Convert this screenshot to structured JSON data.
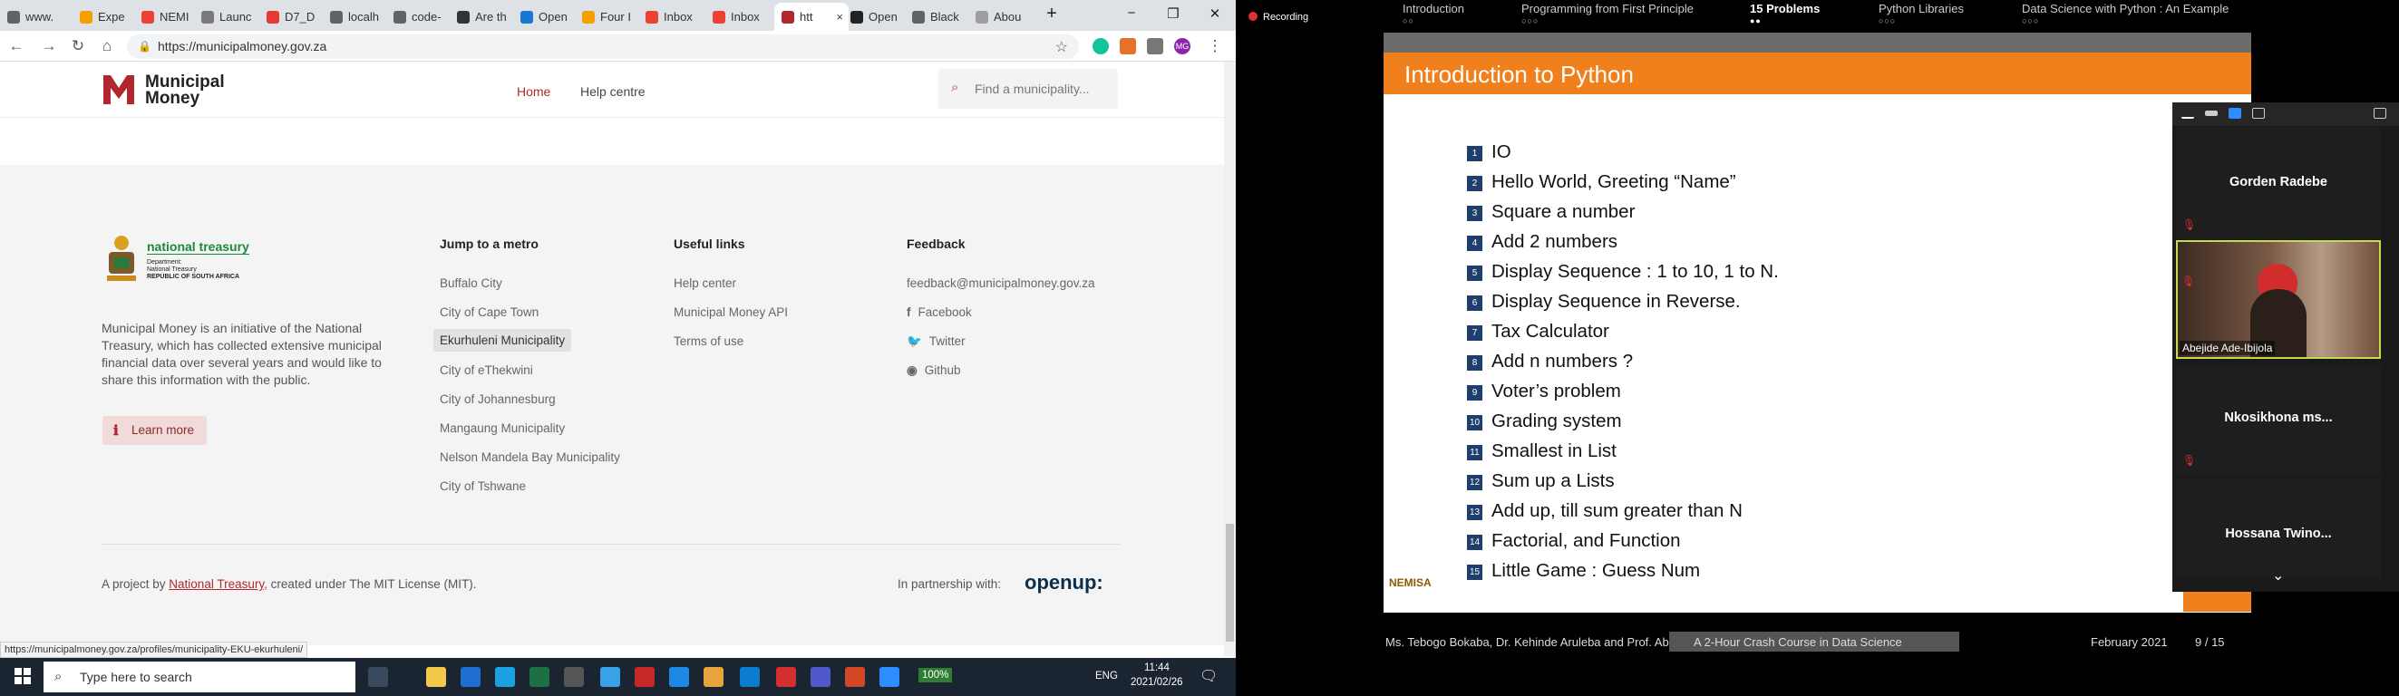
{
  "browser": {
    "tabs": [
      {
        "label": "www.",
        "color": "#5f6368"
      },
      {
        "label": "Expe",
        "color": "#f4a100"
      },
      {
        "label": "NEMI",
        "color": "#ea4335"
      },
      {
        "label": "Launc",
        "color": "#7a7a7a"
      },
      {
        "label": "D7_D",
        "color": "#e53935"
      },
      {
        "label": "localh",
        "color": "#5f6368"
      },
      {
        "label": "code-",
        "color": "#5f6368"
      },
      {
        "label": "Are th",
        "color": "#333333"
      },
      {
        "label": "Open",
        "color": "#1976d2"
      },
      {
        "label": "Four I",
        "color": "#f4a100"
      },
      {
        "label": "Inbox",
        "color": "#ea4335"
      },
      {
        "label": "Inbox",
        "color": "#ea4335"
      },
      {
        "label": "htt",
        "color": "#b0282e"
      },
      {
        "label": "Open",
        "color": "#222222"
      },
      {
        "label": "Black",
        "color": "#5f6368"
      },
      {
        "label": "Abou",
        "color": "#9e9e9e"
      }
    ],
    "active_tab_close": "×",
    "new_tab": "+",
    "win_min": "−",
    "win_max": "❐",
    "win_close": "✕",
    "url": "https://municipalmoney.gov.za",
    "avatar": "MG",
    "status_url": "https://municipalmoney.gov.za/profiles/municipality-EKU-ekurhuleni/"
  },
  "site": {
    "logo_line1": "Municipal",
    "logo_line2": "Money",
    "nav_home": "Home",
    "nav_help": "Help centre",
    "search_placeholder": "Find a municipality...",
    "treasury_name": "national treasury",
    "treasury_line1": "Department:",
    "treasury_line2": "National Treasury",
    "treasury_line3": "REPUBLIC OF SOUTH AFRICA",
    "description": "Municipal Money is an initiative of the National Treasury, which has collected extensive municipal financial data over several years and would like to share this information with the public.",
    "learn_more": "Learn more",
    "metro_heading": "Jump to a metro",
    "metros": [
      "Buffalo City",
      "City of Cape Town",
      "Ekurhuleni Municipality",
      "City of eThekwini",
      "City of Johannesburg",
      "Mangaung Municipality",
      "Nelson Mandela Bay Municipality",
      "City of Tshwane"
    ],
    "useful_heading": "Useful links",
    "useful": [
      "Help center",
      "Municipal Money API",
      "Terms of use"
    ],
    "feedback_heading": "Feedback",
    "feedback_email": "feedback@municipalmoney.gov.za",
    "social": [
      "Facebook",
      "Twitter",
      "Github"
    ],
    "credit_pre": "A project by ",
    "credit_link": "National Treasury",
    "credit_post": ", created under The MIT License (MIT).",
    "partner_label": "In partnership with:",
    "partner_logo": "openup:"
  },
  "taskbar": {
    "search": "Type here to search",
    "battery": "100%",
    "lang": "ENG",
    "time": "11:44",
    "date": "2021/02/26"
  },
  "zoom": {
    "recording": "Recording",
    "sections": [
      {
        "title": "Introduction",
        "dots": "○○"
      },
      {
        "title": "Programming from First Principle",
        "dots": "○○○"
      },
      {
        "title": "15 Problems",
        "dots": "●●"
      },
      {
        "title": "Python Libraries",
        "dots": "○○○"
      },
      {
        "title": "Data Science with Python : An Example",
        "dots": "○○○"
      }
    ],
    "slide_title": "Introduction to Python",
    "items": [
      "IO",
      "Hello World, Greeting “Name”",
      "Square a number",
      "Add 2 numbers",
      "Display Sequence : 1 to 10, 1 to N.",
      "Display Sequence in Reverse.",
      "Tax Calculator",
      "Add n numbers ?",
      "Voter’s problem",
      "Grading system",
      "Smallest in List",
      "Sum up a Lists",
      "Add up, till sum greater than N",
      "Factorial, and Function",
      "Little Game : Guess Num"
    ],
    "slide_logo": "NEMISA",
    "foot_authors": "Ms. Tebogo Bokaba, Dr. Kehinde Aruleba and Prof. Ab",
    "foot_course": "A 2-Hour Crash Course in Data Science",
    "foot_date": "February 2021",
    "foot_page": "9 / 15",
    "participants": [
      "Gorden Radebe",
      "Abejide Ade-Ibijola",
      "Nkosikhona  ms...",
      "Hossana  Twino..."
    ],
    "chevron": "⌄"
  }
}
